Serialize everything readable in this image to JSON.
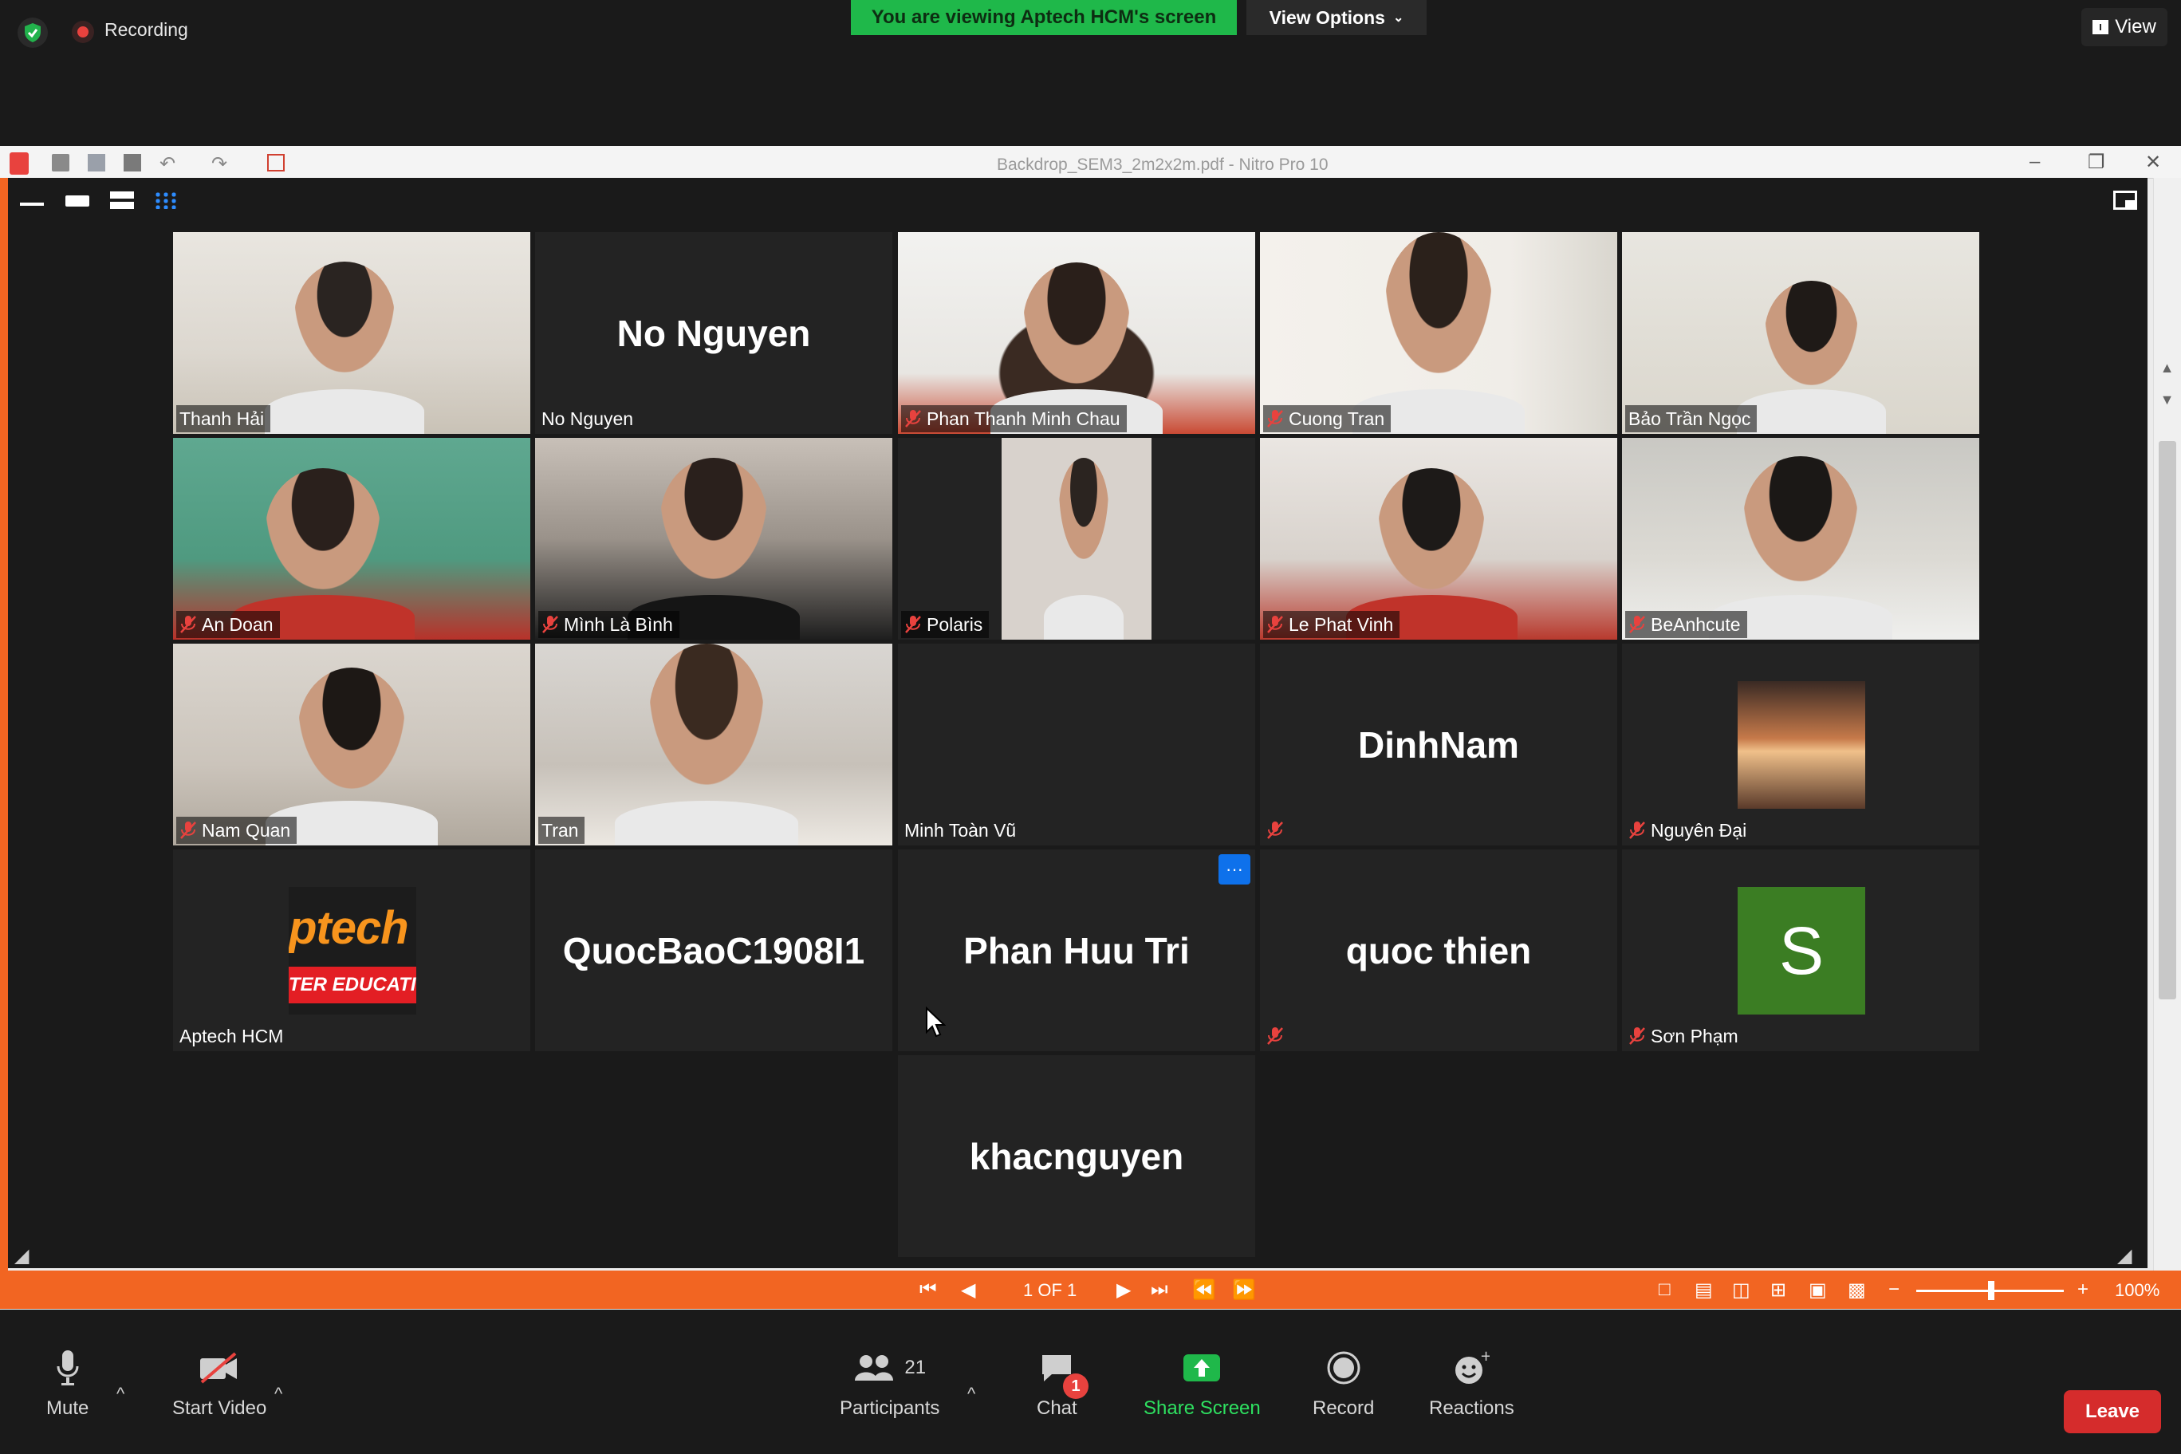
{
  "topbar": {
    "recording_label": "Recording",
    "viewing_banner": "You are viewing Aptech HCM's screen",
    "view_options": "View Options",
    "view_button": "View"
  },
  "shared_window": {
    "title": "Backdrop_SEM3_2m2x2m.pdf - Nitro Pro 10",
    "page_indicator": "1 OF 1",
    "zoom": "100%"
  },
  "gallery": {
    "tiles": [
      {
        "name": "Thanh Hải",
        "muted": false,
        "video": true,
        "active": true
      },
      {
        "name": "No Nguyen",
        "muted": false,
        "video": false,
        "big": "No Nguyen"
      },
      {
        "name": "Phan Thanh Minh Chau",
        "muted": true,
        "video": true
      },
      {
        "name": "Cuong Tran",
        "muted": true,
        "video": true
      },
      {
        "name": "Bảo Trần Ngọc",
        "muted": false,
        "video": true
      },
      {
        "name": "An Doan",
        "muted": true,
        "video": true
      },
      {
        "name": "Mình Là Bình",
        "muted": true,
        "video": true
      },
      {
        "name": "Polaris",
        "muted": true,
        "video": true
      },
      {
        "name": "Le Phat Vinh",
        "muted": true,
        "video": true
      },
      {
        "name": "BeAnhcute",
        "muted": true,
        "video": true
      },
      {
        "name": "Nam Quan",
        "muted": true,
        "video": true
      },
      {
        "name": "Tran",
        "muted": false,
        "video": true
      },
      {
        "name": "Minh Toàn Vũ",
        "muted": false,
        "video": false
      },
      {
        "name": "",
        "muted": true,
        "video": false,
        "big": "DinhNam"
      },
      {
        "name": "Nguyên Đại",
        "muted": true,
        "video": false,
        "avatar": "photo"
      },
      {
        "name": "Aptech HCM",
        "muted": false,
        "video": false,
        "logo_text_1": "ptech",
        "logo_text_2": "TER EDUCATIO"
      },
      {
        "name": "",
        "muted": false,
        "video": false,
        "big": "QuocBaoC1908I1"
      },
      {
        "name": "",
        "muted": false,
        "video": false,
        "big": "Phan Huu Tri",
        "more": "···"
      },
      {
        "name": "",
        "muted": true,
        "video": false,
        "big": "quoc thien"
      },
      {
        "name": "Sơn Phạm",
        "muted": true,
        "video": false,
        "avatar_letter": "S"
      },
      {
        "name": "",
        "muted": false,
        "video": false,
        "big": "khacnguyen"
      }
    ]
  },
  "toolbar": {
    "mute": "Mute",
    "start_video": "Start Video",
    "participants": "Participants",
    "participants_count": "21",
    "chat": "Chat",
    "chat_badge": "1",
    "share_screen": "Share Screen",
    "record": "Record",
    "reactions": "Reactions",
    "leave": "Leave"
  },
  "colors": {
    "banner_green": "#1fb84a",
    "nitro_orange": "#f26522",
    "active_speaker": "#c3d94a",
    "leave_red": "#d52c2c",
    "avatar_green": "#3b7d23"
  }
}
